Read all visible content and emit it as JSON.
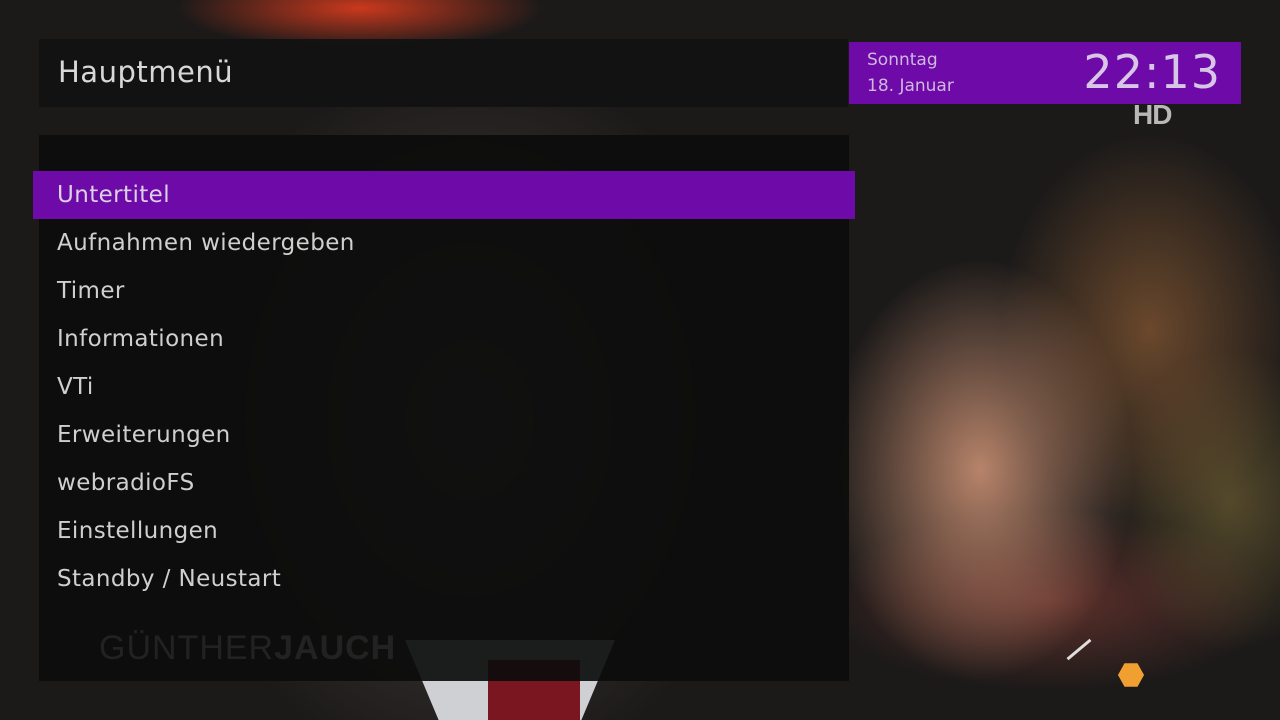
{
  "header": {
    "title": "Hauptmenü"
  },
  "clock": {
    "day": "Sonntag",
    "date": "18. Januar",
    "time": "22:13"
  },
  "badge": {
    "label": "HD"
  },
  "menu": {
    "selected_index": 0,
    "items": [
      {
        "label": "Untertitel"
      },
      {
        "label": "Aufnahmen wiedergeben"
      },
      {
        "label": "Timer"
      },
      {
        "label": "Informationen"
      },
      {
        "label": "VTi"
      },
      {
        "label": "Erweiterungen"
      },
      {
        "label": "webradioFS"
      },
      {
        "label": "Einstellungen"
      },
      {
        "label": "Standby / Neustart"
      }
    ]
  },
  "background": {
    "watermark_light": "GÜNTHER",
    "watermark_bold": "JAUCH"
  },
  "colors": {
    "accent": "#6e0aa8",
    "panel": "#121212",
    "text": "#cfcfcf"
  }
}
